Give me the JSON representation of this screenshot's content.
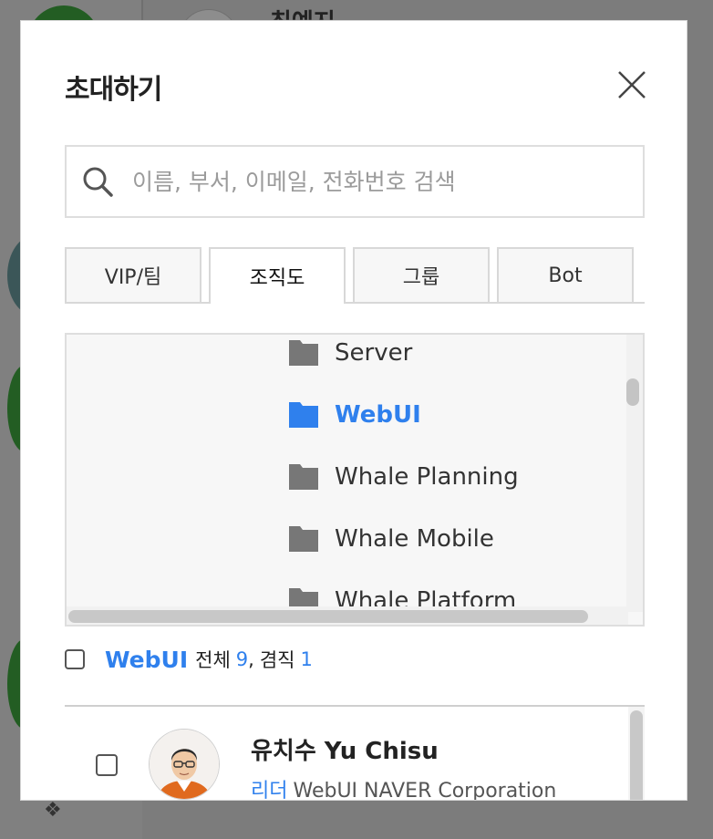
{
  "background": {
    "partial_name": "최예지"
  },
  "modal": {
    "title": "초대하기",
    "close_icon": "close-icon"
  },
  "search": {
    "placeholder": "이름, 부서, 이메일, 전화번호 검색",
    "icon": "search-icon"
  },
  "tabs": [
    {
      "label": "VIP/팀",
      "active": false
    },
    {
      "label": "조직도",
      "active": true
    },
    {
      "label": "그룹",
      "active": false
    },
    {
      "label": "Bot",
      "active": false
    }
  ],
  "tree": {
    "items": [
      {
        "label": "Server",
        "selected": false
      },
      {
        "label": "WebUI",
        "selected": true
      },
      {
        "label": "Whale Planning",
        "selected": false
      },
      {
        "label": "Whale Mobile",
        "selected": false
      },
      {
        "label": "Whale Platform",
        "selected": false
      }
    ],
    "folder_color": "#777777",
    "selected_color": "#2f80ed"
  },
  "summary": {
    "dept": "WebUI",
    "total_label": "전체",
    "total": "9",
    "separator": ",",
    "concurrent_label": "겸직",
    "concurrent": "1"
  },
  "members": [
    {
      "name": "유치수 Yu Chisu",
      "role": "리더",
      "info": "WebUI NAVER Corporation"
    }
  ],
  "colors": {
    "accent": "#2f80ed",
    "overlay": "#7c7c7c"
  }
}
